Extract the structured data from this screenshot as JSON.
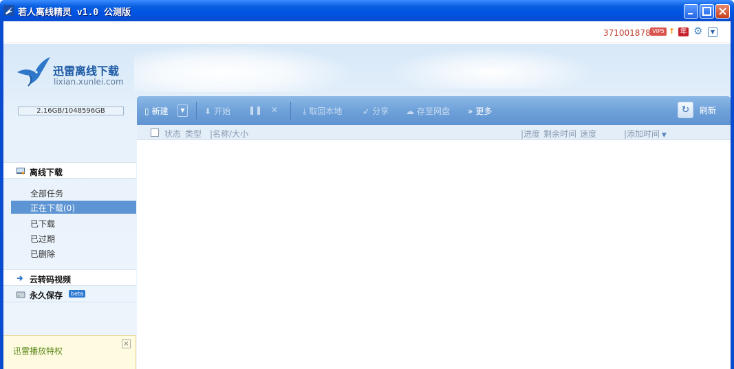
{
  "window": {
    "title": "若人离线精灵 v1.0 公测版"
  },
  "account": {
    "id": "371001878",
    "vip_badge": "VIP5",
    "year_badge": "年"
  },
  "logo": {
    "name_cn": "迅雷离线下载",
    "domain": "lixian.xunlei.com"
  },
  "storage": {
    "usage": "2.16GB/1048596GB"
  },
  "sidebar": {
    "offline_section": "离线下载",
    "items": [
      {
        "label": "全部任务",
        "active": false
      },
      {
        "label": "正在下载(0)",
        "active": true
      },
      {
        "label": "已下载",
        "active": false
      },
      {
        "label": "已过期",
        "active": false
      },
      {
        "label": "已删除",
        "active": false
      }
    ],
    "cloud_transcode": "云转码视频",
    "permanent_save": "永久保存",
    "beta": "beta"
  },
  "promo": {
    "text": "迅雷播放特权"
  },
  "toolbar": {
    "new": "新建",
    "start": "开始",
    "download_local": "取回本地",
    "share": "分享",
    "save_cloud": "存至网盘",
    "more": "更多",
    "refresh": "刷新"
  },
  "columns": {
    "status": "状态",
    "type": "类型",
    "name_size": "|名称/大小",
    "progress": "|进度",
    "remaining": "剩余时间",
    "speed": "速度",
    "added": "|添加时间"
  },
  "icons": {
    "app": "lightning-icon",
    "minimize": "minimize-icon",
    "maximize": "maximize-icon",
    "close": "close-icon",
    "settings": "gear-icon",
    "dropdown": "chevron-down-icon"
  },
  "colors": {
    "titlebar": "#0054e3",
    "toolbar": "#6fa1d9",
    "active_nav": "#5d94d3",
    "account_id": "#c0392b"
  }
}
